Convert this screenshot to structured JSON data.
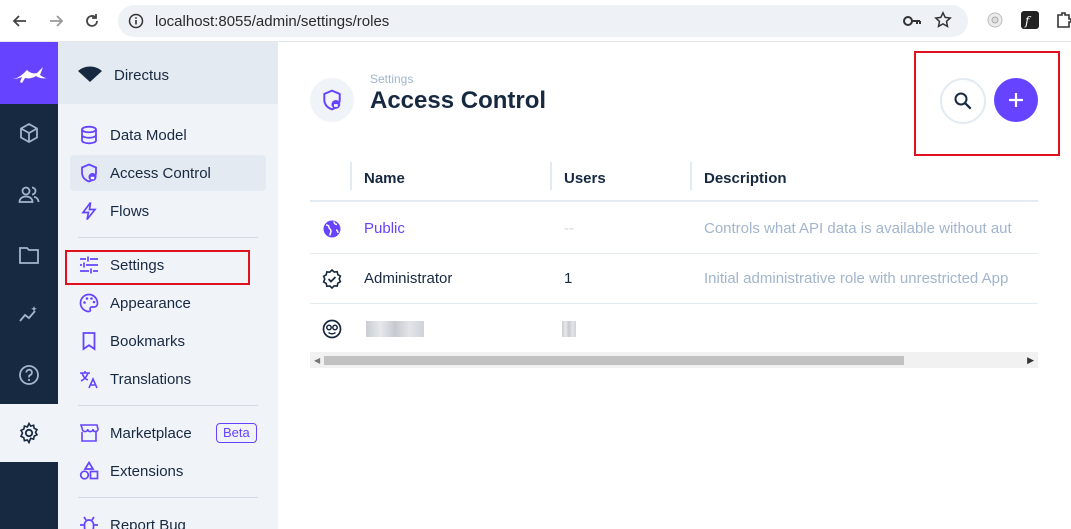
{
  "browser": {
    "url": "localhost:8055/admin/settings/roles"
  },
  "project": {
    "name": "Directus"
  },
  "sidebar": {
    "items": [
      {
        "label": "Data Model",
        "icon": "database-icon"
      },
      {
        "label": "Access Control",
        "icon": "shield-icon"
      },
      {
        "label": "Flows",
        "icon": "bolt-icon"
      },
      {
        "label": "Settings",
        "icon": "sliders-icon"
      },
      {
        "label": "Appearance",
        "icon": "palette-icon"
      },
      {
        "label": "Bookmarks",
        "icon": "bookmark-icon"
      },
      {
        "label": "Translations",
        "icon": "translate-icon"
      },
      {
        "label": "Marketplace",
        "icon": "storefront-icon",
        "badge": "Beta"
      },
      {
        "label": "Extensions",
        "icon": "shapes-icon"
      },
      {
        "label": "Report Bug",
        "icon": "bug-icon"
      }
    ]
  },
  "header": {
    "breadcrumb": "Settings",
    "title": "Access Control"
  },
  "table": {
    "columns": [
      "Name",
      "Users",
      "Description"
    ],
    "rows": [
      {
        "name": "Public",
        "users": "--",
        "description": "Controls what API data is available without aut"
      },
      {
        "name": "Administrator",
        "users": "1",
        "description": "Initial administrative role with unrestricted App"
      }
    ]
  },
  "colors": {
    "accent": "#6644ff",
    "dark": "#172940",
    "highlight": "#e0101e"
  }
}
